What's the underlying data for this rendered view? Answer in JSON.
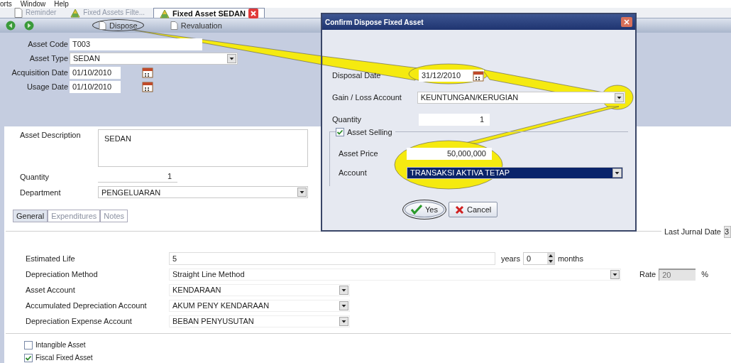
{
  "menu_bar": [
    "orts",
    "Window",
    "Help"
  ],
  "document_tabs": [
    {
      "label": "Reminder",
      "selected": false
    },
    {
      "label": "Fixed Assets Filte...",
      "selected": false
    },
    {
      "label": "Fixed Asset SEDAN",
      "selected": true
    }
  ],
  "toolbar": {
    "buttons": [
      {
        "label": "Dispose",
        "highlighted": true
      },
      {
        "label": "Revaluation",
        "highlighted": false
      }
    ]
  },
  "header_fields": [
    {
      "label": "Asset Code",
      "value": "T003",
      "kind": "text"
    },
    {
      "label": "Asset Type",
      "value": "SEDAN",
      "kind": "dropdown"
    },
    {
      "label": "Acquisition Date",
      "value": "01/10/2010",
      "kind": "date"
    },
    {
      "label": "Usage Date",
      "value": "01/10/2010",
      "kind": "date"
    }
  ],
  "details": {
    "asset_description": {
      "label": "Asset Description",
      "value": "SEDAN"
    },
    "quantity": {
      "label": "Quantity",
      "value": "1"
    },
    "department": {
      "label": "Department",
      "value": "PENGELUARAN"
    }
  },
  "form_tabs": [
    {
      "label": "General",
      "selected": true
    },
    {
      "label": "Expenditures",
      "selected": false
    },
    {
      "label": "Notes",
      "selected": false
    }
  ],
  "general": {
    "last_jurnal_date": {
      "label": "Last Jurnal Date",
      "value": "3"
    },
    "estimated_life": {
      "label": "Estimated Life",
      "years": "5",
      "years_label": "years",
      "months": "0",
      "months_label": "months"
    },
    "depreciation_method": {
      "label": "Depreciation Method",
      "value": "Straight Line Method"
    },
    "rate": {
      "label": "Rate",
      "value": "20",
      "unit": "%",
      "disabled": true
    },
    "accounts": [
      {
        "label": "Asset Account",
        "value": "KENDARAAN"
      },
      {
        "label": "Accumulated Depreciation Account",
        "value": "AKUM PENY KENDARAAN"
      },
      {
        "label": "Depreciation Expense Account",
        "value": "BEBAN PENYUSUTAN"
      }
    ],
    "checkboxes": [
      {
        "label": "Intangible Asset",
        "checked": false
      },
      {
        "label": "Fiscal Fixed Asset",
        "checked": true
      }
    ]
  },
  "dialog": {
    "title": "Confirm Dispose Fixed Asset",
    "disposal_date": {
      "label": "Disposal Date",
      "value": "31/12/2010"
    },
    "gain_loss_account": {
      "label": "Gain / Loss Account",
      "value": "KEUNTUNGAN/KERUGIAN"
    },
    "quantity": {
      "label": "Quantity",
      "value": "1"
    },
    "asset_selling": {
      "label": "Asset Selling",
      "checked": true
    },
    "asset_price": {
      "label": "Asset Price",
      "value": "50,000,000"
    },
    "account": {
      "label": "Account",
      "value": "TRANSAKSI AKTIVA TETAP",
      "selected": true
    },
    "buttons": [
      {
        "label": "Yes",
        "highlighted": true
      },
      {
        "label": "Cancel",
        "highlighted": false
      }
    ]
  }
}
